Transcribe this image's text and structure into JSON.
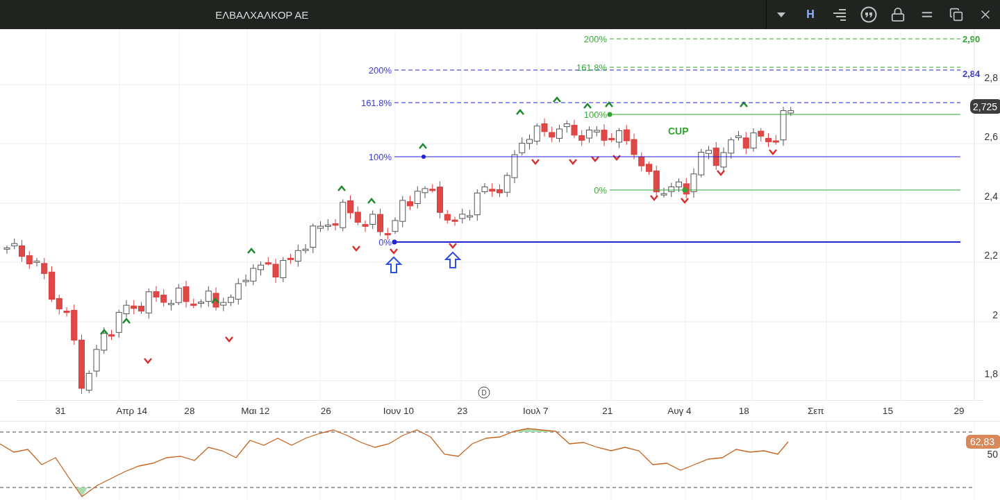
{
  "window": {
    "title": "ΕΛΒΑΛΧΑΛΚΟΡ ΑΕ"
  },
  "toolbar": {
    "mode_label": "H"
  },
  "price_chart": {
    "y_ticks": [
      "2,8",
      "2,6",
      "2,4",
      "2,2",
      "2",
      "1,8"
    ],
    "last_price": "2,725",
    "fib_blue": {
      "levels": [
        {
          "label": "200%"
        },
        {
          "label": "161.8%"
        },
        {
          "label": "100%"
        },
        {
          "label": "0%"
        }
      ],
      "target": "2,84"
    },
    "fib_green": {
      "levels": [
        {
          "label": "200%"
        },
        {
          "label": "161.8%"
        },
        {
          "label": "100%"
        },
        {
          "label": "0%"
        }
      ],
      "target": "2,90"
    },
    "pattern_label": "CUP",
    "event_marker": "D"
  },
  "time_axis": {
    "ticks": [
      "31",
      "Απρ 14",
      "28",
      "Μαι 12",
      "26",
      "Ιουν 10",
      "23",
      "Ιουλ 7",
      "21",
      "Αυγ 4",
      "18",
      "Σεπ",
      "15",
      "29"
    ]
  },
  "oscillator": {
    "reading": "62,83",
    "tick": "50"
  }
}
